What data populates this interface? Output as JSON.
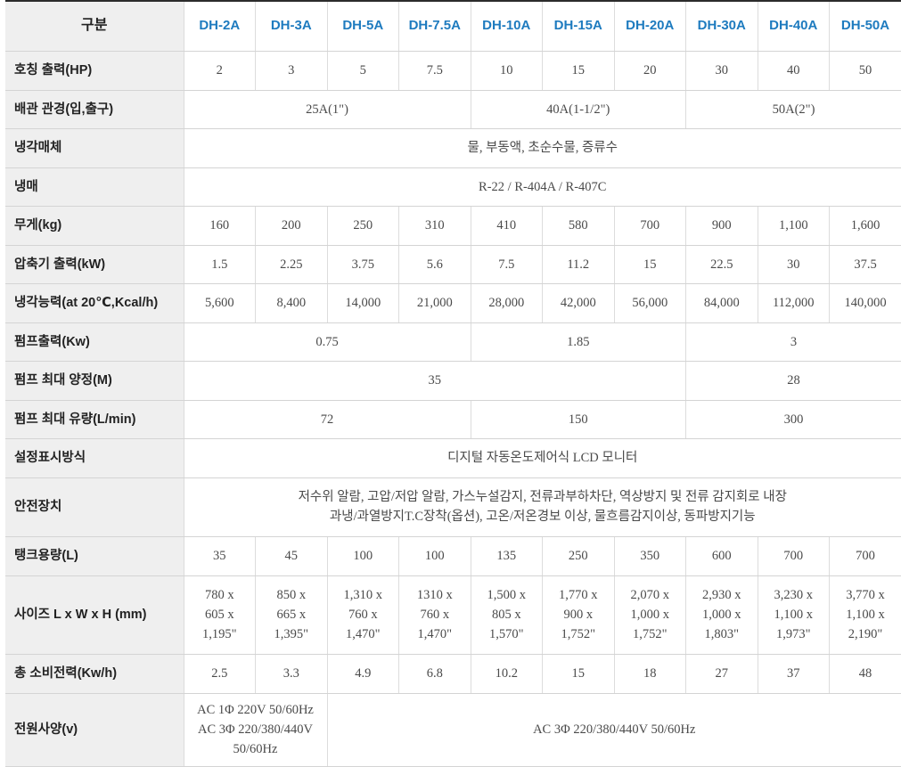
{
  "table": {
    "header": {
      "label": "구분",
      "models": [
        "DH-2A",
        "DH-3A",
        "DH-5A",
        "DH-7.5A",
        "DH-10A",
        "DH-15A",
        "DH-20A",
        "DH-30A",
        "DH-40A",
        "DH-50A"
      ]
    },
    "rows": {
      "hp": {
        "label": "호칭 출력(HP)",
        "values": [
          "2",
          "3",
          "5",
          "7.5",
          "10",
          "15",
          "20",
          "30",
          "40",
          "50"
        ]
      },
      "pipe": {
        "label": "배관 관경(입,출구)",
        "groups": [
          "25A(1\")",
          "40A(1-1/2\")",
          "50A(2\")"
        ]
      },
      "coolant": {
        "label": "냉각매체",
        "value": "물, 부동액, 초순수물, 증류수"
      },
      "refrigerant": {
        "label": "냉매",
        "value": "R-22 / R-404A / R-407C"
      },
      "weight": {
        "label": "무게(kg)",
        "values": [
          "160",
          "200",
          "250",
          "310",
          "410",
          "580",
          "700",
          "900",
          "1,100",
          "1,600"
        ]
      },
      "compressor": {
        "label": "압축기 출력(kW)",
        "values": [
          "1.5",
          "2.25",
          "3.75",
          "5.6",
          "7.5",
          "11.2",
          "15",
          "22.5",
          "30",
          "37.5"
        ]
      },
      "cooling": {
        "label": "냉각능력(at 20℃,Kcal/h)",
        "values": [
          "5,600",
          "8,400",
          "14,000",
          "21,000",
          "28,000",
          "42,000",
          "56,000",
          "84,000",
          "112,000",
          "140,000"
        ]
      },
      "pump_output": {
        "label": "펌프출력(Kw)",
        "groups": [
          "0.75",
          "1.85",
          "3"
        ]
      },
      "pump_head": {
        "label": "펌프 최대 양정(M)",
        "groups": [
          "35",
          "28"
        ]
      },
      "pump_flow": {
        "label": "펌프 최대 유량(L/min)",
        "groups": [
          "72",
          "150",
          "300"
        ]
      },
      "display": {
        "label": "설정표시방식",
        "value": "디지털 자동온도제어식 LCD 모니터"
      },
      "safety": {
        "label": "안전장치",
        "lines": [
          "저수위 알람, 고압/저압 알람, 가스누설감지, 전류과부하차단, 역상방지 및 전류 감지회로 내장",
          "과냉/과열방지T.C장착(옵션), 고온/저온경보 이상, 물흐름감지이상, 동파방지기능"
        ]
      },
      "tank": {
        "label": "탱크용량(L)",
        "values": [
          "35",
          "45",
          "100",
          "100",
          "135",
          "250",
          "350",
          "600",
          "700",
          "700"
        ]
      },
      "size": {
        "label": "사이즈 L x W x H (mm)",
        "values": [
          [
            "780 x",
            "605 x",
            "1,195\""
          ],
          [
            "850 x",
            "665 x",
            "1,395\""
          ],
          [
            "1,310 x",
            "760 x",
            "1,470\""
          ],
          [
            "1310 x",
            "760 x",
            "1,470\""
          ],
          [
            "1,500 x",
            "805 x",
            "1,570\""
          ],
          [
            "1,770 x",
            "900 x",
            "1,752\""
          ],
          [
            "2,070 x",
            "1,000 x",
            "1,752\""
          ],
          [
            "2,930 x",
            "1,000 x",
            "1,803\""
          ],
          [
            "3,230 x",
            "1,100 x",
            "1,973\""
          ],
          [
            "3,770 x",
            "1,100 x",
            "2,190\""
          ]
        ]
      },
      "power": {
        "label": "총 소비전력(Kw/h)",
        "values": [
          "2.5",
          "3.3",
          "4.9",
          "6.8",
          "10.2",
          "15",
          "18",
          "27",
          "37",
          "48"
        ]
      },
      "supply": {
        "label": "전원사양(v)",
        "first_lines": [
          "AC 1Φ 220V 50/60Hz",
          "AC 3Φ 220/380/440V",
          "50/60Hz"
        ],
        "rest": "AC 3Φ 220/380/440V 50/60Hz"
      }
    }
  }
}
